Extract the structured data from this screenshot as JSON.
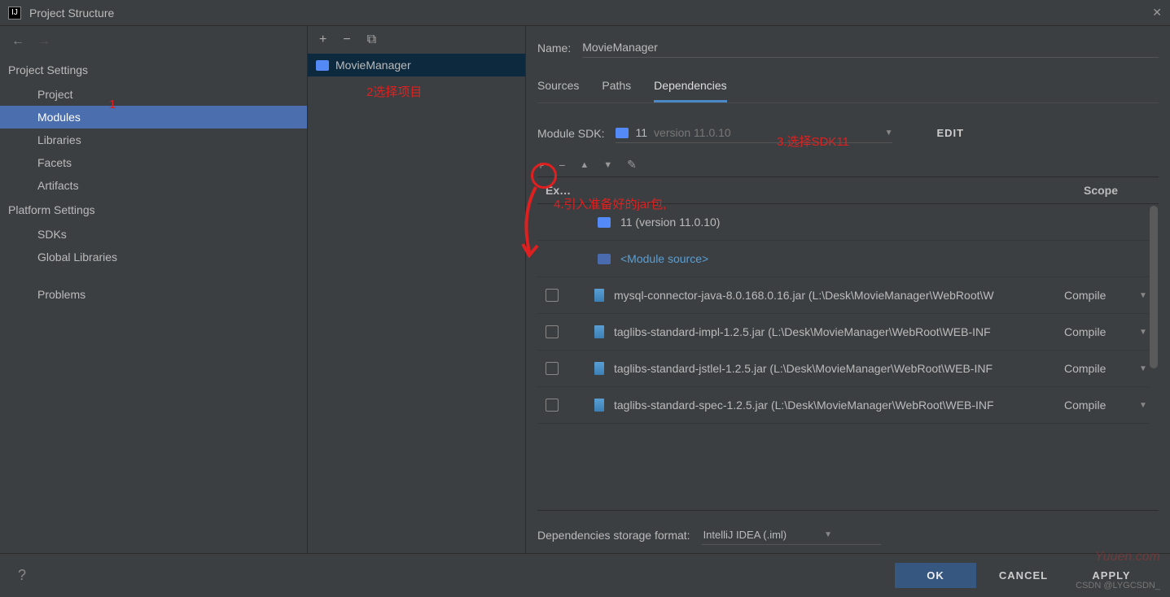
{
  "window": {
    "title": "Project Structure"
  },
  "nav": {
    "back": "←",
    "fwd": "→"
  },
  "sections": {
    "project_settings": "Project Settings",
    "platform_settings": "Platform Settings"
  },
  "sidebar": {
    "items": [
      {
        "label": "Project"
      },
      {
        "label": "Modules"
      },
      {
        "label": "Libraries"
      },
      {
        "label": "Facets"
      },
      {
        "label": "Artifacts"
      },
      {
        "label": "SDKs"
      },
      {
        "label": "Global Libraries"
      },
      {
        "label": "Problems"
      }
    ]
  },
  "middle": {
    "add": "+",
    "remove": "−",
    "copy": "⧉",
    "module": "MovieManager"
  },
  "right": {
    "name_label": "Name:",
    "name_value": "MovieManager",
    "tabs": {
      "sources": "Sources",
      "paths": "Paths",
      "dependencies": "Dependencies"
    },
    "sdk_label": "Module SDK:",
    "sdk_name": "11",
    "sdk_version": "version 11.0.10",
    "edit": "EDIT",
    "toolbar": {
      "add": "+",
      "remove": "−",
      "up": "▲",
      "down": "▼",
      "edit": "✎"
    },
    "header": {
      "export": "Ex…",
      "scope": "Scope"
    },
    "deps": [
      {
        "type": "sdk",
        "label": "11 (version 11.0.10)"
      },
      {
        "type": "modsrc",
        "label": "<Module source>"
      },
      {
        "type": "jar",
        "label": "mysql-connector-java-8.0.168.0.16.jar (L:\\Desk\\MovieManager\\WebRoot\\W",
        "scope": "Compile"
      },
      {
        "type": "jar",
        "label": "taglibs-standard-impl-1.2.5.jar (L:\\Desk\\MovieManager\\WebRoot\\WEB-INF",
        "scope": "Compile"
      },
      {
        "type": "jar",
        "label": "taglibs-standard-jstlel-1.2.5.jar (L:\\Desk\\MovieManager\\WebRoot\\WEB-INF",
        "scope": "Compile"
      },
      {
        "type": "jar",
        "label": "taglibs-standard-spec-1.2.5.jar (L:\\Desk\\MovieManager\\WebRoot\\WEB-INF",
        "scope": "Compile"
      }
    ],
    "storage_label": "Dependencies storage format:",
    "storage_value": "IntelliJ IDEA (.iml)"
  },
  "footer": {
    "help": "?",
    "ok": "OK",
    "cancel": "CANCEL",
    "apply": "APPLY"
  },
  "annotations": {
    "a1": "1",
    "a2": "2选择项目",
    "a3": "3.选择SDK11",
    "a4": "4.引入准备好的jar包,"
  },
  "watermark": "Yuuen.com",
  "csdn": "CSDN @LYGCSDN_"
}
